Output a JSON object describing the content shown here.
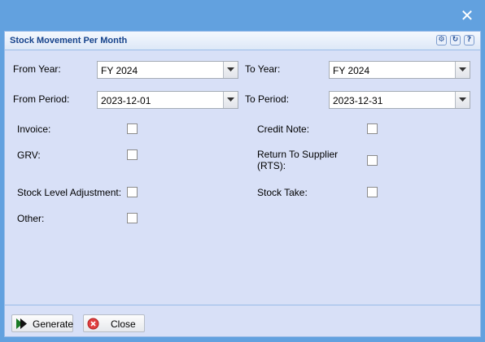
{
  "window": {
    "close_icon": "close-icon"
  },
  "panel": {
    "title": "Stock Movement Per Month",
    "tools": [
      "gear-icon",
      "refresh-icon",
      "help-icon"
    ]
  },
  "form": {
    "from_year_label": "From Year:",
    "from_year_value": "FY 2024",
    "to_year_label": "To Year:",
    "to_year_value": "FY 2024",
    "from_period_label": "From Period:",
    "from_period_value": "2023-12-01",
    "to_period_label": "To Period:",
    "to_period_value": "2023-12-31",
    "checkboxes": {
      "invoice": {
        "label": "Invoice:",
        "checked": false
      },
      "credit_note": {
        "label": "Credit Note:",
        "checked": false
      },
      "grv": {
        "label": "GRV:",
        "checked": false
      },
      "rts": {
        "label": "Return To Supplier (RTS):",
        "checked": false
      },
      "stock_level_adjustment": {
        "label": "Stock Level Adjustment:",
        "checked": false
      },
      "stock_take": {
        "label": "Stock Take:",
        "checked": false
      },
      "other": {
        "label": "Other:",
        "checked": false
      }
    }
  },
  "footer": {
    "generate_label": "Generate",
    "close_label": "Close"
  },
  "colors": {
    "background": "#62a1df",
    "panel_bg": "#d8e0f7",
    "title_text": "#15428b",
    "generate_icon": "#1a7a25",
    "close_icon": "#e04040"
  }
}
